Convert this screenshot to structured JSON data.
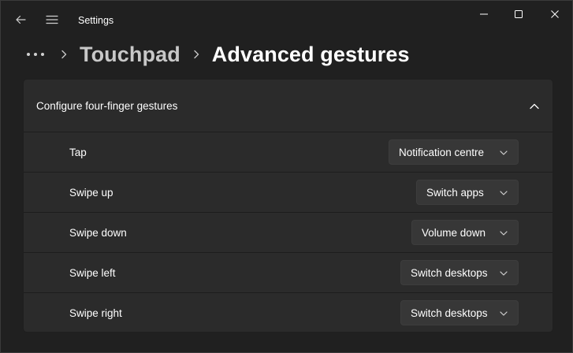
{
  "app": {
    "title": "Settings"
  },
  "breadcrumb": {
    "parent": "Touchpad",
    "current": "Advanced gestures"
  },
  "section": {
    "title": "Configure four-finger gestures",
    "expanded": true
  },
  "gestures": [
    {
      "label": "Tap",
      "value": "Notification centre"
    },
    {
      "label": "Swipe up",
      "value": "Switch apps"
    },
    {
      "label": "Swipe down",
      "value": "Volume down"
    },
    {
      "label": "Swipe left",
      "value": "Switch desktops"
    },
    {
      "label": "Swipe right",
      "value": "Switch desktops"
    }
  ],
  "icons": {
    "back": "back-arrow-icon",
    "menu": "hamburger-menu-icon",
    "more": "more-dots-icon",
    "separator": "chevron-right-icon",
    "collapse": "chevron-up-icon",
    "dropdown": "chevron-down-icon"
  },
  "colors": {
    "background": "#202020",
    "card": "#2b2b2b",
    "control": "#373737",
    "text": "#ffffff",
    "muted_text": "#c8c8c8"
  }
}
